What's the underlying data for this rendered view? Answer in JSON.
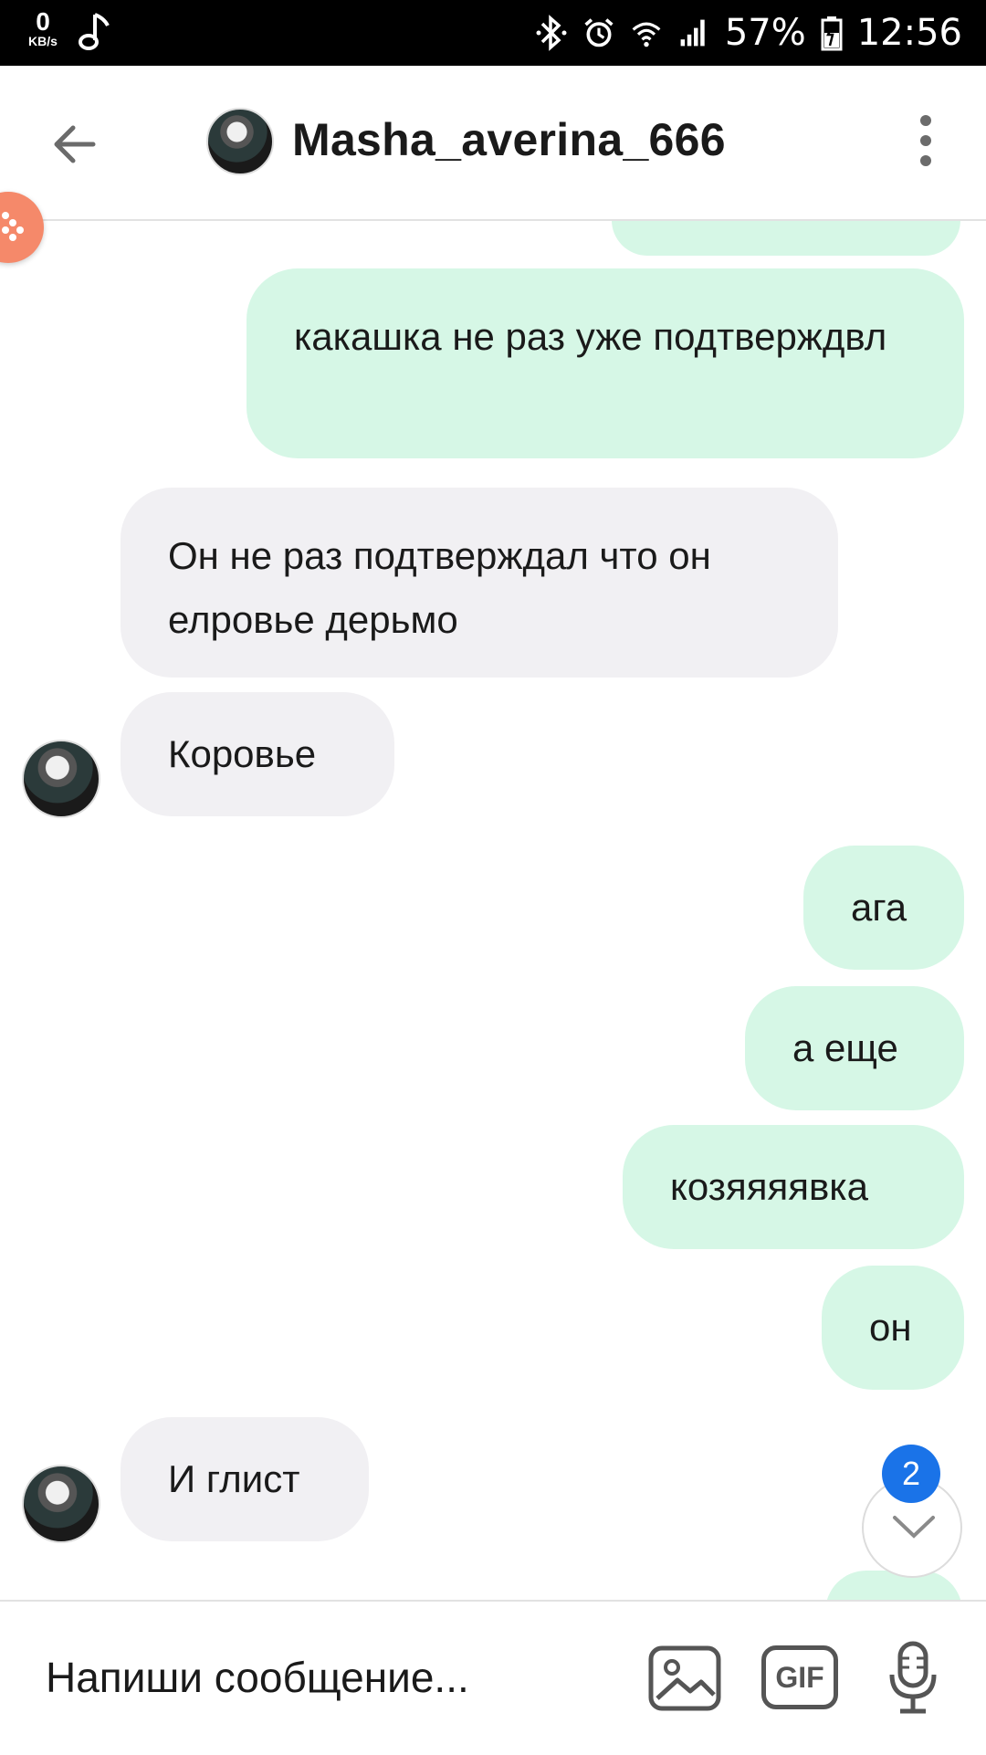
{
  "status_bar": {
    "speed_value": "0",
    "speed_unit": "KB/s",
    "battery_percent": "57%",
    "time": "12:56"
  },
  "header": {
    "title": "Masha_averina_666"
  },
  "messages": [
    {
      "side": "out",
      "text": "какашка не раз уже подтверждвл"
    },
    {
      "side": "in",
      "text": "Он не раз подтверждал что он елровье дерьмо"
    },
    {
      "side": "in",
      "text": "Коровье"
    },
    {
      "side": "out",
      "text": "ага"
    },
    {
      "side": "out",
      "text": "а еще"
    },
    {
      "side": "out",
      "text": "козяяяявка"
    },
    {
      "side": "out",
      "text": "он"
    },
    {
      "side": "in",
      "text": "И глист"
    }
  ],
  "unread_count": "2",
  "composer": {
    "placeholder": "Напиши сообщение...",
    "gif_label": "GIF"
  },
  "colors": {
    "outgoing_bubble": "#d6f7e6",
    "incoming_bubble": "#f1f0f3",
    "unread_badge": "#1a73e8",
    "game_badge": "#f5896a"
  }
}
